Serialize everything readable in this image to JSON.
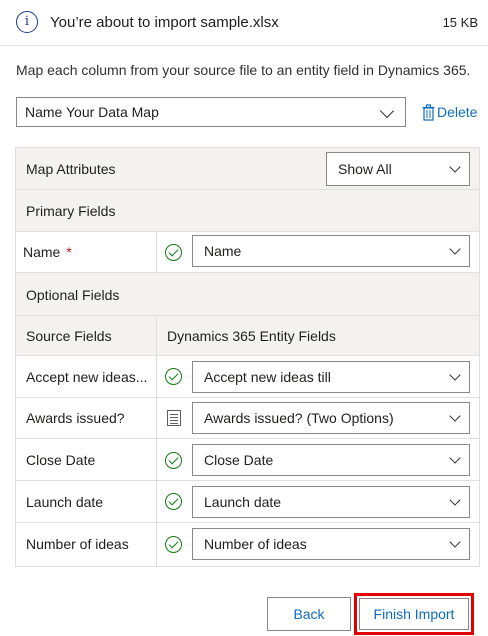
{
  "header": {
    "info_icon": "info-icon",
    "message": "You’re about to import sample.xlsx",
    "file_size": "15 KB"
  },
  "description": "Map each column from your source file to an entity field in Dynamics 365.",
  "data_map": {
    "selected": "Name Your Data Map",
    "delete_label": "Delete"
  },
  "grid": {
    "map_attributes_label": "Map Attributes",
    "filter_selected": "Show All",
    "primary_fields_label": "Primary Fields",
    "primary_rows": [
      {
        "source": "Name",
        "required_mark": "*",
        "status_icon": "check-circle-icon",
        "target": "Name"
      }
    ],
    "optional_fields_label": "Optional Fields",
    "columns": {
      "source": "Source Fields",
      "target": "Dynamics 365 Entity Fields"
    },
    "optional_rows": [
      {
        "source": "Accept new ideas...",
        "status_icon": "check-circle-icon",
        "target": "Accept new ideas till"
      },
      {
        "source": "Awards issued?",
        "status_icon": "document-list-icon",
        "target": "Awards issued? (Two Options)"
      },
      {
        "source": "Close Date",
        "status_icon": "check-circle-icon",
        "target": "Close Date"
      },
      {
        "source": "Launch date",
        "status_icon": "check-circle-icon",
        "target": "Launch date"
      },
      {
        "source": "Number of ideas",
        "status_icon": "check-circle-icon",
        "target": "Number of ideas"
      }
    ]
  },
  "footer": {
    "back_label": "Back",
    "finish_label": "Finish Import"
  },
  "colors": {
    "accent": "#0f6cbd",
    "success": "#107c10",
    "required": "#c50f1f",
    "highlight": "#e00000"
  }
}
